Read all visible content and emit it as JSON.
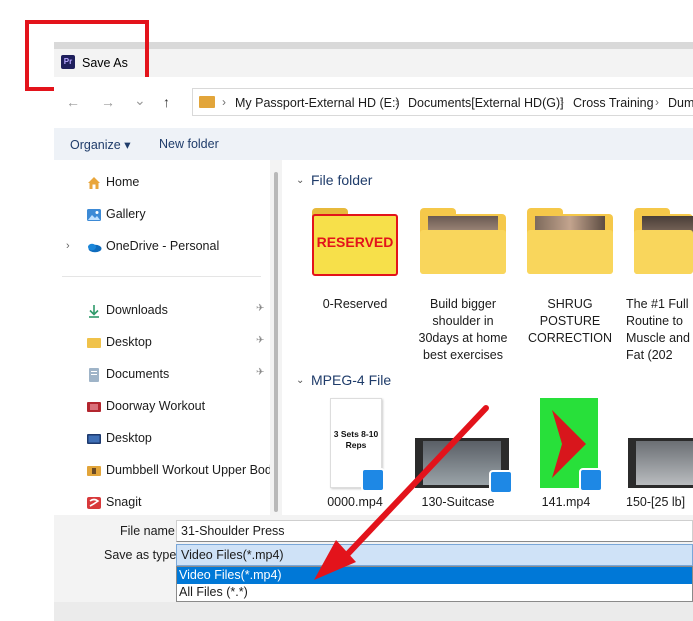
{
  "window": {
    "title": "Save As",
    "app_icon_text": "Pr"
  },
  "nav": {
    "back": "←",
    "forward": "→",
    "recent": "⌄",
    "up": "↑",
    "breadcrumbs": [
      "My Passport-External HD (E:)",
      "Documents[External HD(G)]",
      "Cross Training",
      "Dum"
    ],
    "separator": "›"
  },
  "toolbar": {
    "organize": "Organize ▾",
    "new_folder": "New folder"
  },
  "sidebar": {
    "items": [
      {
        "label": "Home"
      },
      {
        "label": "Gallery"
      },
      {
        "label": "OneDrive - Personal"
      },
      {
        "label": "Downloads"
      },
      {
        "label": "Desktop"
      },
      {
        "label": "Documents"
      },
      {
        "label": "Doorway Workout"
      },
      {
        "label": "Desktop"
      },
      {
        "label": "Dumbbell Workout Upper Bod"
      },
      {
        "label": "Snagit"
      }
    ],
    "pin_glyph": "📌"
  },
  "groups": {
    "folders": {
      "title": "File folder",
      "items": [
        {
          "label": "0-Reserved",
          "thumb_text": "RESERVED"
        },
        {
          "label": "Build bigger shoulder in 30days at home best exercises"
        },
        {
          "label": "SHRUG POSTURE CORRECTION"
        },
        {
          "label": "The #1 Full Routine to Muscle and Fat (202"
        }
      ]
    },
    "videos": {
      "title": "MPEG-4 File",
      "items": [
        {
          "label": "0000.mp4",
          "thumb_text": "3 Sets 8-10 Reps"
        },
        {
          "label": "130-Suitcase"
        },
        {
          "label": "141.mp4"
        },
        {
          "label": "150-[25 lb]"
        }
      ]
    }
  },
  "fields": {
    "file_name_label": "File name:",
    "file_name_value": "31-Shoulder Press",
    "save_type_label": "Save as type:",
    "save_type_value": "Video Files(*.mp4)",
    "options": [
      "Video Files(*.mp4)",
      "All Files (*.*)"
    ]
  },
  "colors": {
    "annotation_red": "#e3131b",
    "accent": "#0078d7",
    "folder": "#f5c84a"
  }
}
